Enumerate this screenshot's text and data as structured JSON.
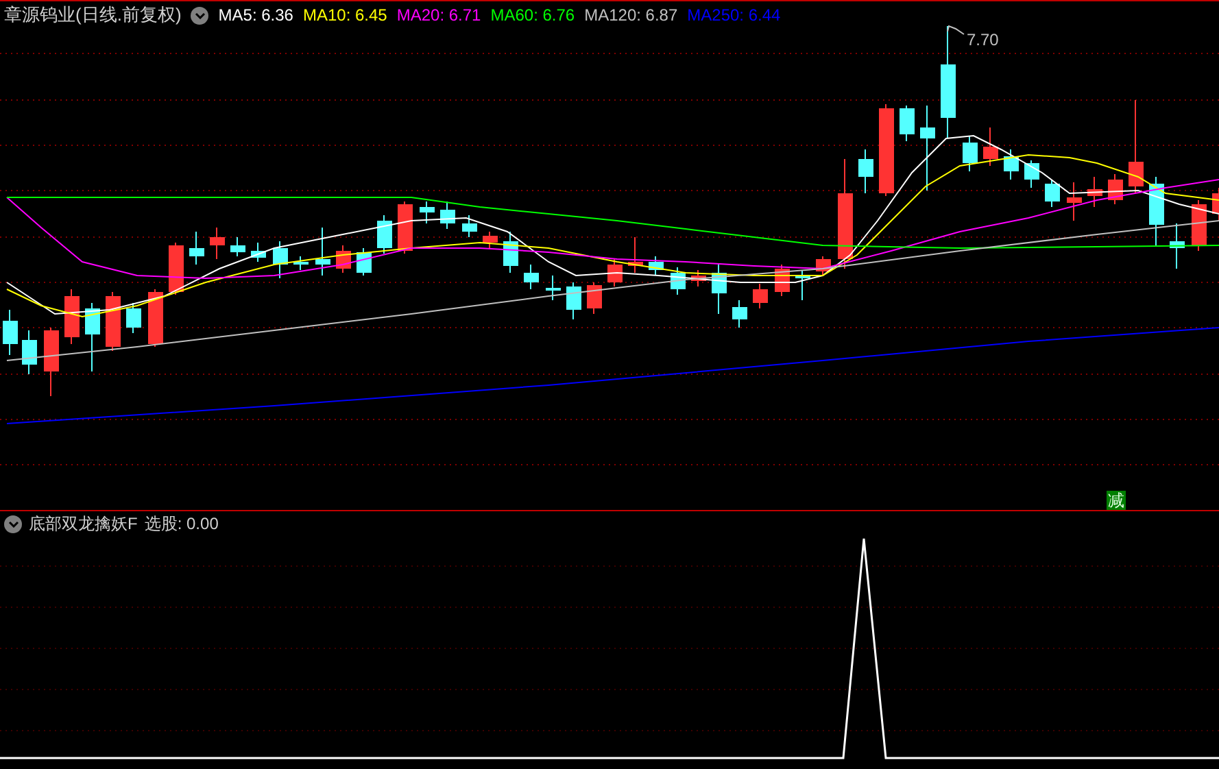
{
  "price_panel": {
    "stock_title": "章源钨业(日线.前复权)",
    "moving_averages": [
      {
        "label": "MA5: 6.36",
        "color": "#ffffff"
      },
      {
        "label": "MA10: 6.45",
        "color": "#ffff00"
      },
      {
        "label": "MA20: 6.71",
        "color": "#ff00ff"
      },
      {
        "label": "MA60: 6.76",
        "color": "#00ff00"
      },
      {
        "label": "MA120: 6.87",
        "color": "#c0c0c0"
      },
      {
        "label": "MA250: 6.44",
        "color": "#0000ff"
      }
    ],
    "high_marker": "7.70",
    "signal_badge": "减"
  },
  "indicator_panel": {
    "name": "底部双龙擒妖F",
    "reading": "选股: 0.00"
  }
}
